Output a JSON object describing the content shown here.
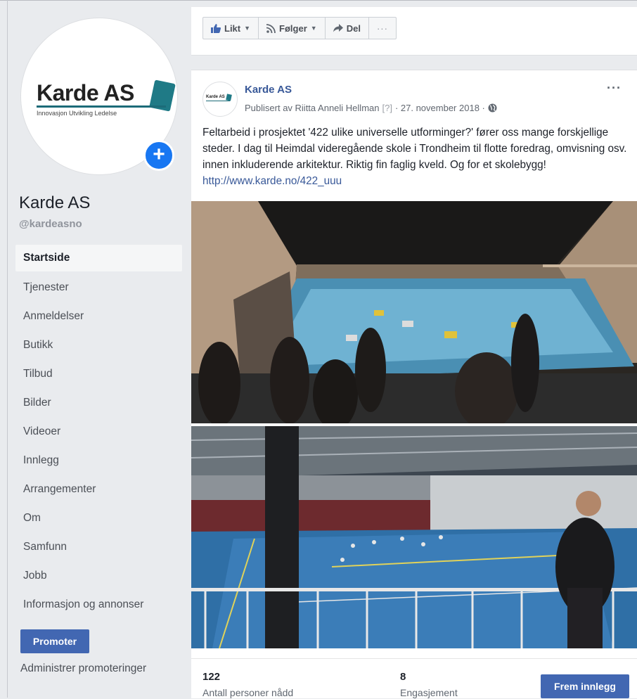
{
  "page": {
    "logo_title": "Karde AS",
    "logo_subtitle": "Innovasjon Utvikling Ledelse",
    "name": "Karde AS",
    "handle": "@kardeasno"
  },
  "nav": {
    "items": [
      {
        "label": "Startside",
        "active": true
      },
      {
        "label": "Tjenester"
      },
      {
        "label": "Anmeldelser"
      },
      {
        "label": "Butikk"
      },
      {
        "label": "Tilbud"
      },
      {
        "label": "Bilder"
      },
      {
        "label": "Videoer"
      },
      {
        "label": "Innlegg"
      },
      {
        "label": "Arrangementer"
      },
      {
        "label": "Om"
      },
      {
        "label": "Samfunn"
      },
      {
        "label": "Jobb"
      },
      {
        "label": "Informasjon og annonser"
      }
    ],
    "promote_label": "Promoter",
    "manage_promotions_label": "Administrer promoteringer"
  },
  "actions": {
    "like_label": "Likt",
    "follow_label": "Følger",
    "share_label": "Del",
    "more_label": "···"
  },
  "post": {
    "author": "Karde AS",
    "published_by": "Publisert av Riitta Anneli Hellman",
    "help_marker": "[?]",
    "date": "· 27. november 2018 ·",
    "menu": "···",
    "text": "Feltarbeid i prosjektet '422 ulike universelle utforminger?' fører oss mange forskjellige steder. I dag til Heimdal videregående skole i Trondheim til flotte foredrag, omvisning osv. innen inkluderende arkitektur. Riktig fin faglig kveld. Og for et skolebygg!",
    "link": "http://www.karde.no/422_uuu"
  },
  "stats": {
    "reach_value": "122",
    "reach_label": "Antall personer nådd",
    "engagement_value": "8",
    "engagement_label": "Engasjement",
    "boost_label": "Frem innlegg"
  },
  "colors": {
    "brand_blue": "#4267b2",
    "link_blue": "#385898",
    "logo_teal": "#1f7a86"
  }
}
